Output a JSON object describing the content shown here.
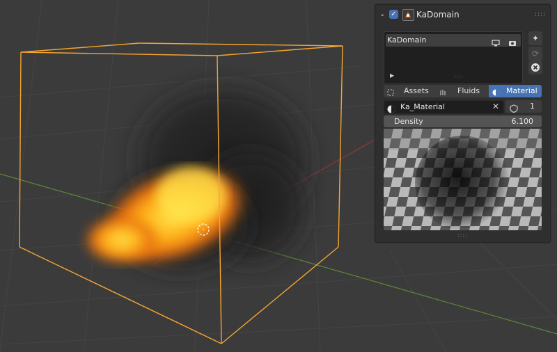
{
  "panel": {
    "title": "KaDomain",
    "list_item_label": "KaDomain",
    "tabs": [
      {
        "label": "Assets"
      },
      {
        "label": "Fluids"
      },
      {
        "label": "Material"
      }
    ],
    "material": {
      "name": "Ka_Material",
      "users": "1"
    },
    "density": {
      "label": "Density",
      "value": "6.100"
    }
  },
  "colors": {
    "accent": "#4772b3",
    "selection": "#f5a530",
    "panel_bg": "#2f2f2f"
  },
  "icons": [
    "chevron-down-icon",
    "checkbox-icon",
    "addon-icon",
    "grip-icon",
    "monitor-icon",
    "camera-icon",
    "play-icon",
    "magic-wand-icon",
    "refresh-icon",
    "close-circle-icon",
    "assets-icon",
    "fluids-icon",
    "material-icon",
    "shield-icon"
  ]
}
